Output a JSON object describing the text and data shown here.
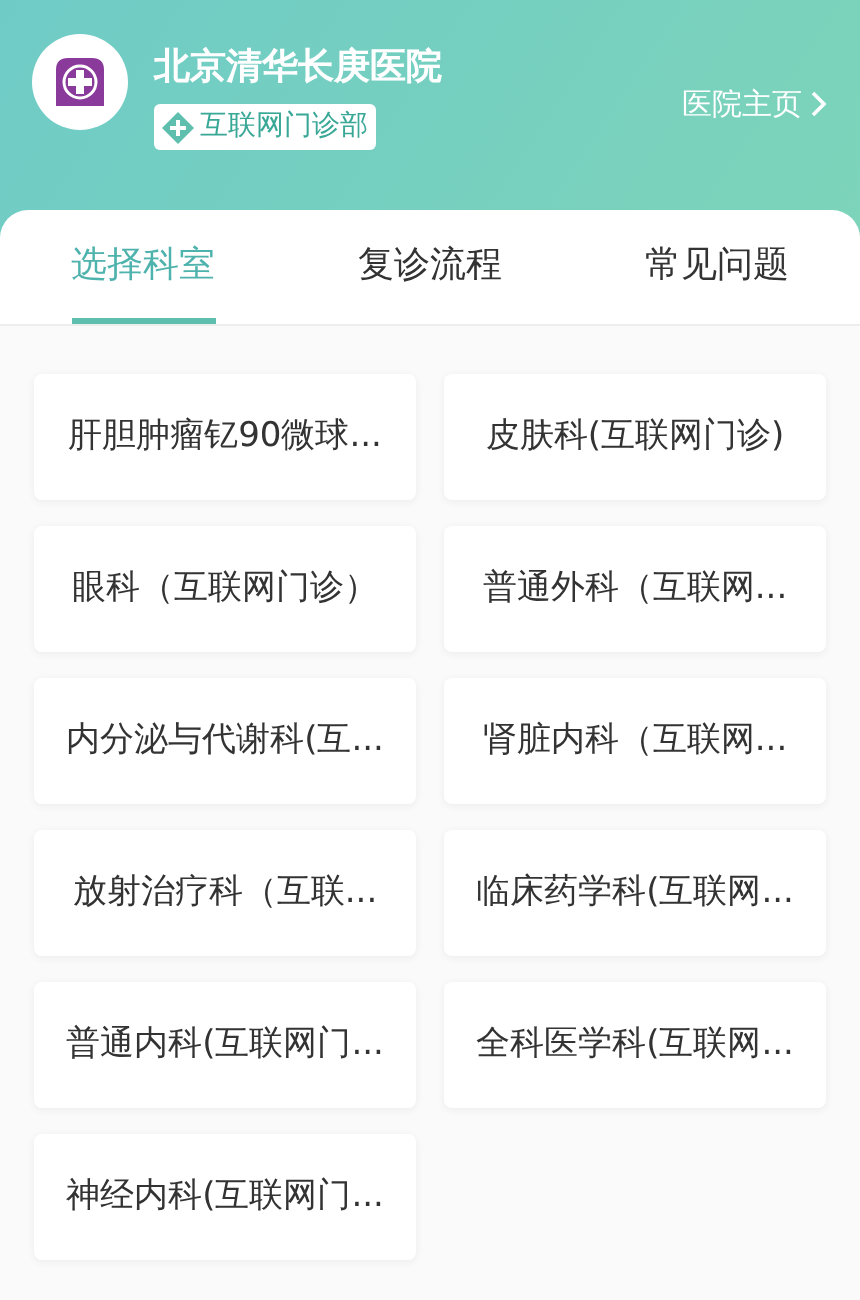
{
  "header": {
    "hospital_name": "北京清华长庚医院",
    "badge": "互联网门诊部",
    "home_link": "医院主页"
  },
  "tabs": [
    {
      "label": "选择科室",
      "selected": true
    },
    {
      "label": "复诊流程",
      "selected": false
    },
    {
      "label": "常见问题",
      "selected": false
    }
  ],
  "departments": [
    "肝胆肿瘤钇90微球...",
    "皮肤科(互联网门诊)",
    "眼科（互联网门诊）",
    "普通外科（互联网...",
    "内分泌与代谢科(互...",
    "肾脏内科（互联网...",
    "放射治疗科（互联...",
    "临床药学科(互联网...",
    "普通内科(互联网门...",
    "全科医学科(互联网...",
    "神经内科(互联网门..."
  ]
}
